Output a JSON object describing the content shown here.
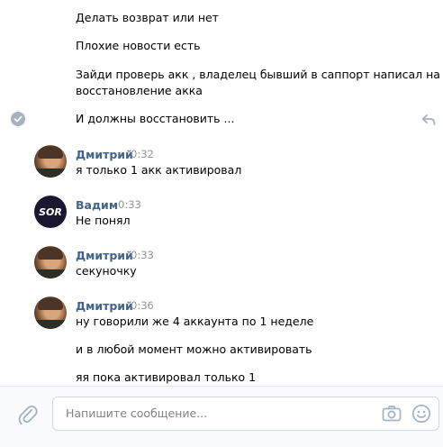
{
  "messages_top": [
    "Делать возврат или нет",
    "Плохие новости есть",
    "Зайди проверь акк , владелец бывший в саппорт написал на",
    "восстановление акка",
    "И должны восстановить ..."
  ],
  "groups": [
    {
      "author": "Дмитрий",
      "time": "0:32",
      "lines": [
        "я только 1 акк активировал"
      ]
    },
    {
      "author": "Вадим",
      "time": "0:33",
      "lines": [
        "Не понял"
      ],
      "avatar_text": "SOR"
    },
    {
      "author": "Дмитрий",
      "time": "0:33",
      "lines": [
        "секуночку"
      ]
    },
    {
      "author": "Дмитрий",
      "time": "0:36",
      "lines": [
        "ну говорили же 4 аккаунта по 1 неделе",
        "и в любой момент можно активировать",
        "яя пока активировал только 1"
      ]
    }
  ],
  "composer": {
    "placeholder": "Напишите сообщение..."
  },
  "colors": {
    "author": "#42648b",
    "time": "#939393",
    "accent_icon": "#a3b2c4",
    "composer_bg": "#fafbfc"
  },
  "icons": [
    "read-check-icon",
    "reply-icon",
    "attach-icon",
    "camera-icon",
    "smile-icon"
  ]
}
